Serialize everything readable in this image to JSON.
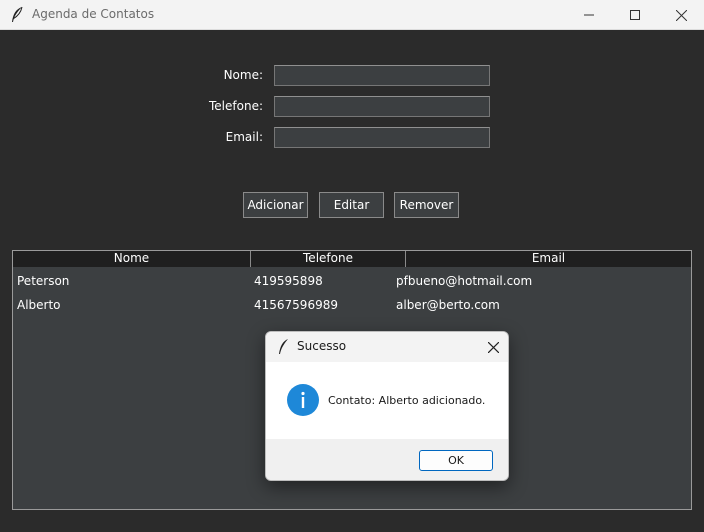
{
  "window": {
    "title": "Agenda de Contatos",
    "icon": "feather-icon"
  },
  "form": {
    "nome_label": "Nome:",
    "telefone_label": "Telefone:",
    "email_label": "Email:",
    "nome_value": "",
    "telefone_value": "",
    "email_value": ""
  },
  "buttons": {
    "add": "Adicionar",
    "edit": "Editar",
    "remove": "Remover"
  },
  "table": {
    "columns": [
      "Nome",
      "Telefone",
      "Email"
    ],
    "rows": [
      [
        "Peterson",
        "419595898",
        "pfbueno@hotmail.com"
      ],
      [
        "Alberto",
        "41567596989",
        "alber@berto.com"
      ]
    ]
  },
  "dialog": {
    "title": "Sucesso",
    "icon": "info-icon",
    "message": "Contato: Alberto adicionado.",
    "ok_label": "OK"
  },
  "colors": {
    "background": "#2b2b2b",
    "field": "#3c3f41",
    "table_header": "#1f1f1f",
    "info_blue": "#1e88d8",
    "accent": "#0067c0"
  }
}
